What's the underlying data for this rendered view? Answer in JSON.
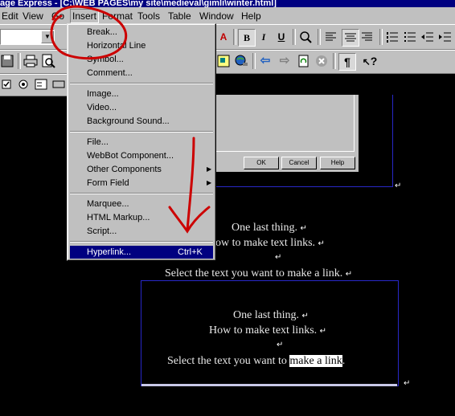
{
  "title": "age Express - [C:\\WEB PAGES\\my site\\medieval\\gimli\\winter.html]",
  "menubar": [
    "Edit",
    "View",
    "Go",
    "Insert",
    "Format",
    "Tools",
    "Table",
    "Window",
    "Help"
  ],
  "insert_menu": {
    "group1": [
      "Break...",
      "Horizontal Line",
      "Symbol...",
      "Comment..."
    ],
    "group2": [
      "Image...",
      "Video...",
      "Background Sound..."
    ],
    "group3": [
      "File...",
      "WebBot Component...",
      "Other Components",
      "Form Field"
    ],
    "group4": [
      "Marquee...",
      "HTML Markup...",
      "Script..."
    ],
    "hyperlink": "Hyperlink...",
    "hyperlink_shortcut": "Ctrl+K"
  },
  "toolbar": {
    "bold": "B",
    "italic": "I",
    "underline": "U",
    "font_color": "A",
    "pilcrow": "¶",
    "help": "?"
  },
  "dialog_buttons": [
    "OK",
    "Cancel",
    "Help"
  ],
  "page_text": {
    "line1": "One last thing.",
    "line2": "How to make text links.",
    "line3": "Select the text you want to make a link.",
    "line2_clipped": "ow to make text links.",
    "line3_prefix": "Select the text you want to ",
    "line3_selected": "make a link",
    "line3_suffix": "."
  },
  "marks": {
    "return": "↵"
  },
  "colors": {
    "menu_highlight": "#000080",
    "annotation": "#cc0000",
    "box_border": "#2828c8"
  }
}
